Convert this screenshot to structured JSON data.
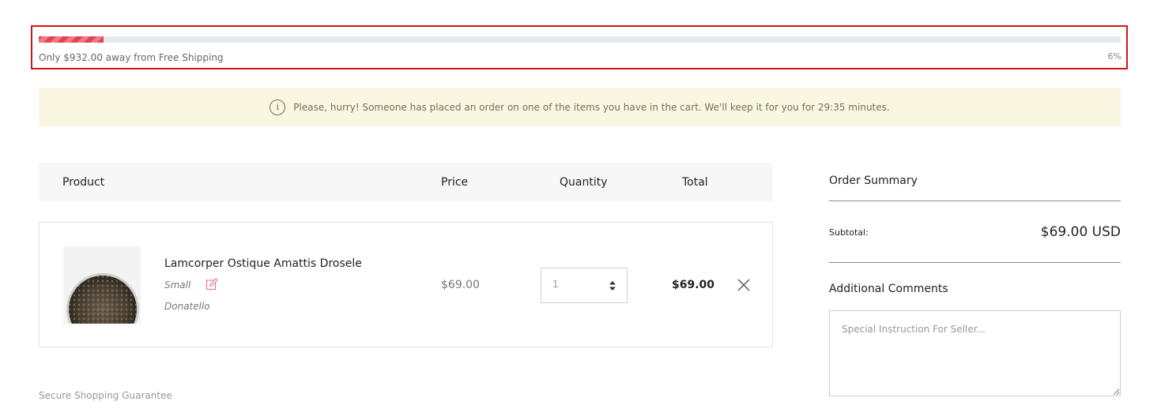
{
  "shipping": {
    "message": "Only $932.00 away from Free Shipping",
    "percent_label": "6%",
    "progress": 0.06,
    "fill_color": "#e04452",
    "highlight_color": "#d4141c"
  },
  "alert": {
    "icon": "info-icon",
    "icon_glyph": "i",
    "text": "Please, hurry! Someone has placed an order on one of the items you have in the cart. We'll keep it for you for 29:35 minutes."
  },
  "cart_table": {
    "headers": {
      "product": "Product",
      "price": "Price",
      "quantity": "Quantity",
      "total": "Total"
    },
    "items": [
      {
        "name": "Lamcorper Ostique Amattis Drosele",
        "variant": "Small",
        "vendor": "Donatello",
        "price": "$69.00",
        "quantity": "1",
        "total": "$69.00"
      }
    ]
  },
  "secure_label": "Secure Shopping Guarantee",
  "summary": {
    "title": "Order Summary",
    "subtotal_label": "Subtotal:",
    "subtotal_value": "$69.00 USD",
    "comments_title": "Additional Comments",
    "comments_placeholder": "Special Instruction For Seller..."
  }
}
